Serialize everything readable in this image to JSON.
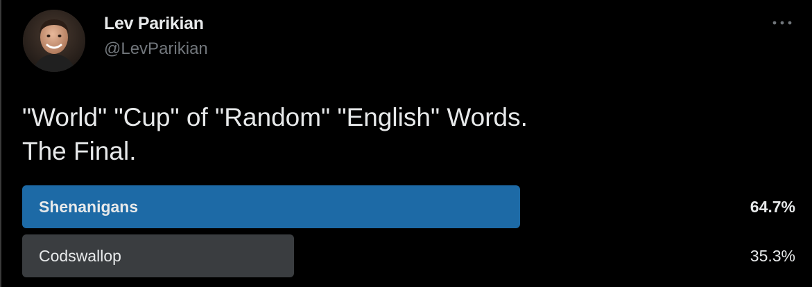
{
  "author": {
    "name": "Lev Parikian",
    "handle": "@LevParikian"
  },
  "tweet": {
    "lines": [
      "\"World\" \"Cup\" of \"Random\" \"English\" Words.",
      "The Final."
    ]
  },
  "poll": {
    "options": [
      {
        "label": "Shenanigans",
        "percent_text": "64.7%",
        "percent": 64.7,
        "winner": true,
        "color": "#1d6aa6"
      },
      {
        "label": "Codswallop",
        "percent_text": "35.3%",
        "percent": 35.3,
        "winner": false,
        "color": "#3a3d40"
      }
    ]
  },
  "icons": {
    "more": "more-horizontal-icon"
  }
}
